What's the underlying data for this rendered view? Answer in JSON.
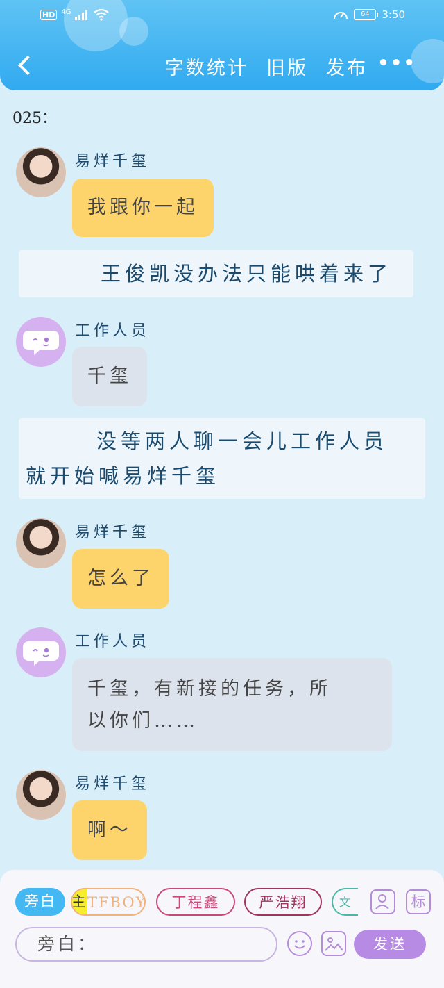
{
  "status_bar": {
    "time": "3:50",
    "battery": "64",
    "network": "4G",
    "hd": "HD"
  },
  "nav": {
    "actions": [
      "字数统计",
      "旧版",
      "发布"
    ],
    "more": "•••"
  },
  "chapter": {
    "number": "025："
  },
  "messages": [
    {
      "type": "chat",
      "speaker": "易烊千玺",
      "avatar": "person",
      "bubble": "yellow",
      "lines": [
        "我跟你一起"
      ]
    },
    {
      "type": "narration",
      "text": "王俊凯没办法只能哄着来了"
    },
    {
      "type": "chat",
      "speaker": "工作人员",
      "avatar": "staff",
      "bubble": "gray",
      "lines": [
        "千玺"
      ]
    },
    {
      "type": "narration",
      "lines": [
        "没等两人聊一会儿工作人员",
        "就开始喊易烊千玺"
      ]
    },
    {
      "type": "chat",
      "speaker": "易烊千玺",
      "avatar": "person",
      "bubble": "yellow",
      "lines": [
        "怎么了"
      ]
    },
    {
      "type": "chat",
      "speaker": "工作人员",
      "avatar": "staff",
      "bubble": "gray",
      "lines": [
        "千玺，有新接的任务，所",
        "以你们……"
      ]
    },
    {
      "type": "chat",
      "speaker": "易烊千玺",
      "avatar": "person",
      "bubble": "yellow",
      "lines": [
        "啊～"
      ]
    }
  ],
  "composer": {
    "chips": [
      "旁白",
      "主",
      "TFBOYS",
      "丁程鑫",
      "严浩翔",
      "文"
    ],
    "tag_label": "标",
    "input_placeholder": "旁白：",
    "send_label": "发送"
  },
  "colors": {
    "topbar": "#31aaf0",
    "background": "#d8eef9",
    "yellow_bubble": "#fdd46b",
    "gray_bubble": "#dde3ec",
    "send": "#b78be4"
  }
}
